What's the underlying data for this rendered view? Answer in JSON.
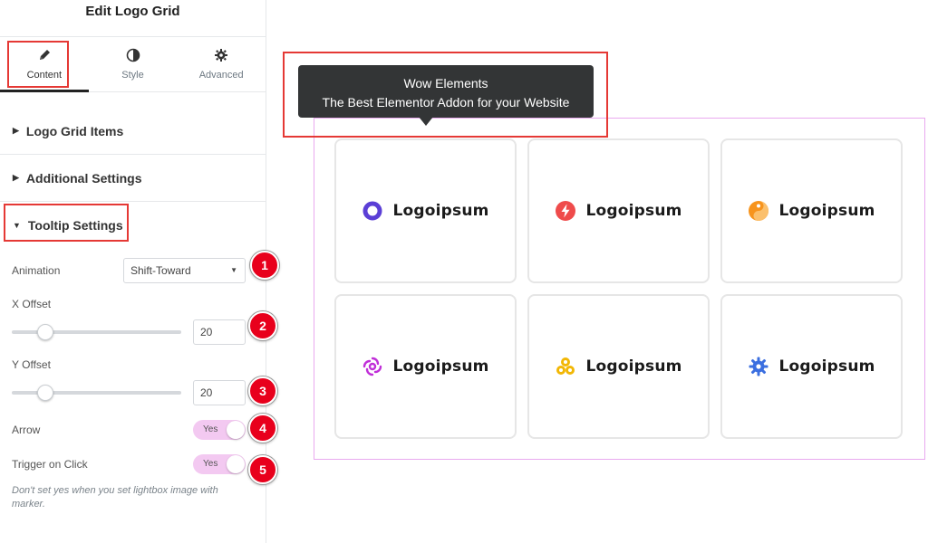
{
  "panel": {
    "title": "Edit Logo Grid",
    "tabs": [
      {
        "label": "Content",
        "icon": "pencil-icon"
      },
      {
        "label": "Style",
        "icon": "half-circle-icon"
      },
      {
        "label": "Advanced",
        "icon": "gear-icon"
      }
    ],
    "sections": [
      {
        "label": "Logo Grid Items",
        "state": "collapsed"
      },
      {
        "label": "Additional Settings",
        "state": "collapsed"
      },
      {
        "label": "Tooltip Settings",
        "state": "expanded"
      }
    ],
    "controls": {
      "animation": {
        "label": "Animation",
        "value": "Shift-Toward"
      },
      "x_offset": {
        "label": "X Offset",
        "value": "20",
        "level": 0.2
      },
      "y_offset": {
        "label": "Y Offset",
        "value": "20",
        "level": 0.2
      },
      "arrow": {
        "label": "Arrow",
        "value": "Yes"
      },
      "trigger": {
        "label": "Trigger on Click",
        "value": "Yes"
      }
    },
    "hint": "Don't set yes when you set lightbox image with marker."
  },
  "badges": [
    "1",
    "2",
    "3",
    "4",
    "5"
  ],
  "preview": {
    "tooltip": {
      "line1": "Wow Elements",
      "line2": "The Best Elementor Addon for your Website"
    },
    "logos": [
      {
        "text": "Logoipsum",
        "icon": "ring-logo-icon",
        "color": "#5b3fd6"
      },
      {
        "text": "Logoipsum",
        "icon": "bolt-logo-icon",
        "color": "#ef4b4b"
      },
      {
        "text": "Logoipsum",
        "icon": "yin-yang-logo-icon",
        "color": "#f7941d"
      },
      {
        "text": "Logoipsum",
        "icon": "swirl-logo-icon",
        "color": "#c02fd8"
      },
      {
        "text": "Logoipsum",
        "icon": "knot-logo-icon",
        "color": "#f2b705"
      },
      {
        "text": "Logoipsum",
        "icon": "gear-logo-icon",
        "color": "#3b6fe0"
      }
    ]
  },
  "colors": {
    "highlight": "#e53935",
    "badge": "#e8001c",
    "toggle": "#f3c9f1",
    "frame": "#e9a9ef",
    "tooltip_bg": "#333536"
  }
}
